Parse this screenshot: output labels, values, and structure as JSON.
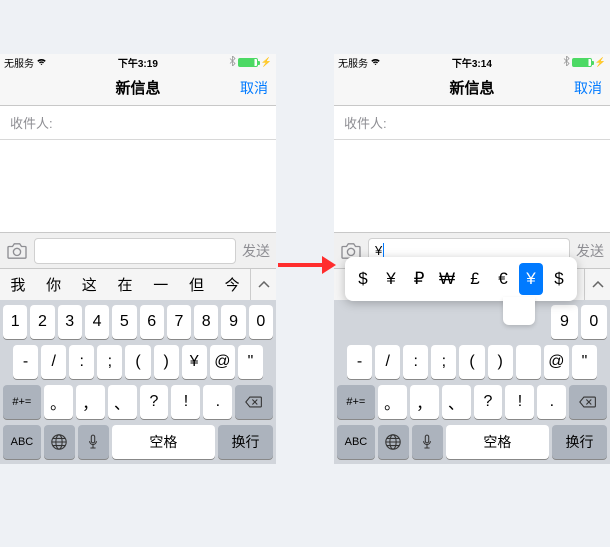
{
  "left": {
    "status": {
      "carrier": "无服务",
      "time": "下午3:19"
    },
    "nav": {
      "title": "新信息",
      "cancel": "取消"
    },
    "recipient_label": "收件人:",
    "send": "发送",
    "candidates": [
      "我",
      "你",
      "这",
      "在",
      "一",
      "但",
      "今"
    ],
    "keyboard": {
      "row1": [
        "1",
        "2",
        "3",
        "4",
        "5",
        "6",
        "7",
        "8",
        "9",
        "0"
      ],
      "row2": [
        "-",
        "/",
        ":",
        ";",
        "(",
        ")",
        "¥",
        "@",
        "\""
      ],
      "row3": [
        "。",
        "，",
        "、",
        "?",
        "!",
        "."
      ],
      "shift_label": "#+=",
      "abc": "ABC",
      "space": "空格",
      "return": "换行"
    }
  },
  "right": {
    "status": {
      "carrier": "无服务",
      "time": "下午3:14"
    },
    "nav": {
      "title": "新信息",
      "cancel": "取消"
    },
    "recipient_label": "收件人:",
    "send": "发送",
    "input_value": "¥",
    "popup": [
      "$",
      "¥",
      "₽",
      "₩",
      "£",
      "€",
      "¥",
      "$"
    ],
    "popup_selected_index": 6,
    "keyboard": {
      "row1_tail": [
        "9",
        "0"
      ],
      "row2": [
        "-",
        "/",
        ":",
        ";",
        "(",
        ")",
        "",
        "@",
        "\""
      ],
      "row3": [
        "。",
        "，",
        "、",
        "?",
        "!",
        "."
      ],
      "shift_label": "#+=",
      "abc": "ABC",
      "space": "空格",
      "return": "换行"
    }
  }
}
